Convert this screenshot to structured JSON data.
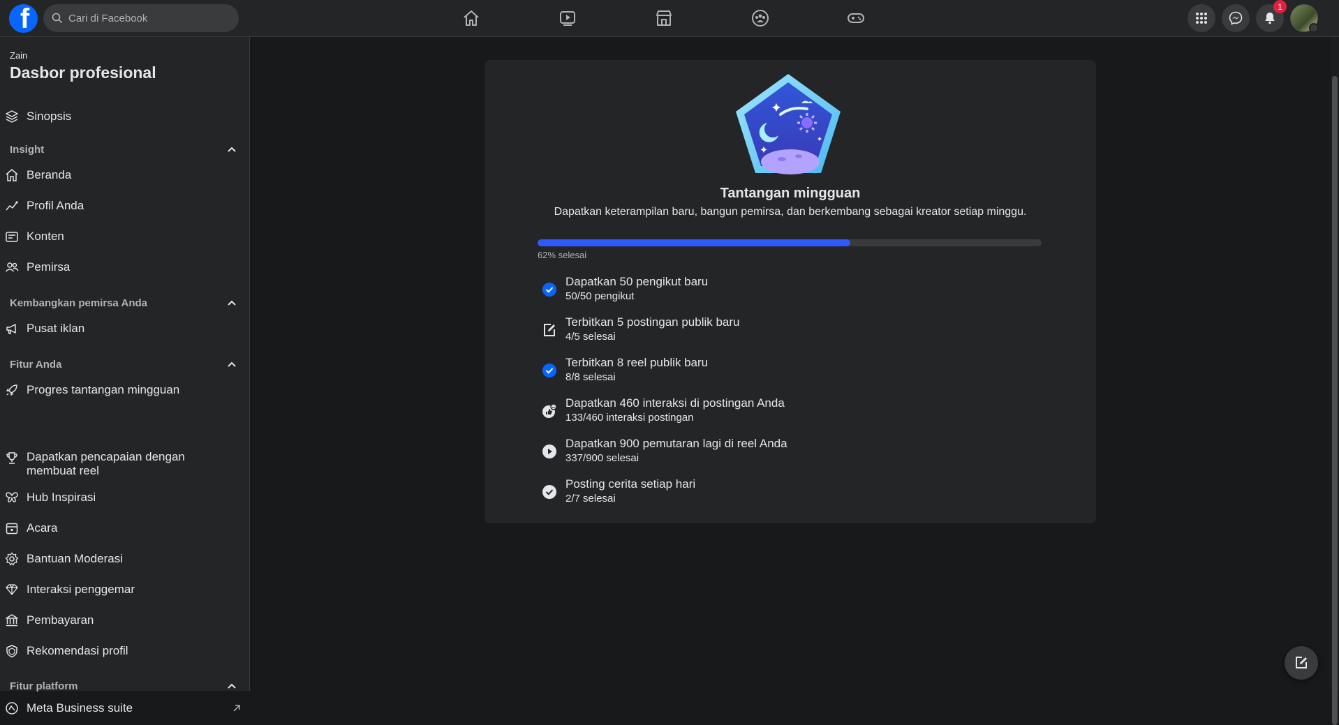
{
  "search": {
    "placeholder": "Cari di Facebook"
  },
  "nav": {
    "icons": [
      "home-icon",
      "video-icon",
      "marketplace-icon",
      "groups-icon",
      "gaming-icon"
    ]
  },
  "notifications": {
    "count": "1"
  },
  "sidebar": {
    "owner": "Zain",
    "title": "Dasbor profesional",
    "overview": "Sinopsis",
    "sections": {
      "insight": "Insight",
      "grow": "Kembangkan pemirsa Anda",
      "features": "Fitur Anda",
      "platform": "Fitur platform"
    },
    "items": {
      "home": "Beranda",
      "profile": "Profil Anda",
      "content": "Konten",
      "audience": "Pemirsa",
      "ads": "Pusat iklan",
      "weekly": "Progres tantangan mingguan",
      "reels_line1": "Dapatkan pencapaian dengan",
      "reels_line2": "membuat reel",
      "inspiration": "Hub Inspirasi",
      "events": "Acara",
      "moderation": "Bantuan Moderasi",
      "fans": "Interaksi penggemar",
      "payments": "Pembayaran",
      "recommend": "Rekomendasi profil",
      "meta": "Meta Business suite"
    }
  },
  "challenge": {
    "title": "Tantangan mingguan",
    "subtitle": "Dapatkan keterampilan baru, bangun pemirsa, dan berkembang sebagai kreator setiap minggu.",
    "progress_fraction": 0.62,
    "progress_label": "62% selesai",
    "tasks": [
      {
        "title": "Dapatkan 50 pengikut baru",
        "sub": "50/50 pengikut",
        "icon": "check-circle-icon"
      },
      {
        "title": "Terbitkan 5 postingan publik baru",
        "sub": "4/5 selesai",
        "icon": "edit-icon"
      },
      {
        "title": "Terbitkan 8 reel publik baru",
        "sub": "8/8 selesai",
        "icon": "check-circle-icon"
      },
      {
        "title": "Dapatkan 460 interaksi di postingan Anda",
        "sub": "133/460 interaksi postingan",
        "icon": "reactions-icon"
      },
      {
        "title": "Dapatkan 900 pemutaran lagi di reel Anda",
        "sub": "337/900 selesai",
        "icon": "play-circle-icon"
      },
      {
        "title": "Posting cerita setiap hari",
        "sub": "2/7 selesai",
        "icon": "check-circle-white-icon"
      }
    ]
  },
  "colors": {
    "accent": "#0866ff",
    "progress": "#2d5bff",
    "badge": "#e41e3f"
  }
}
